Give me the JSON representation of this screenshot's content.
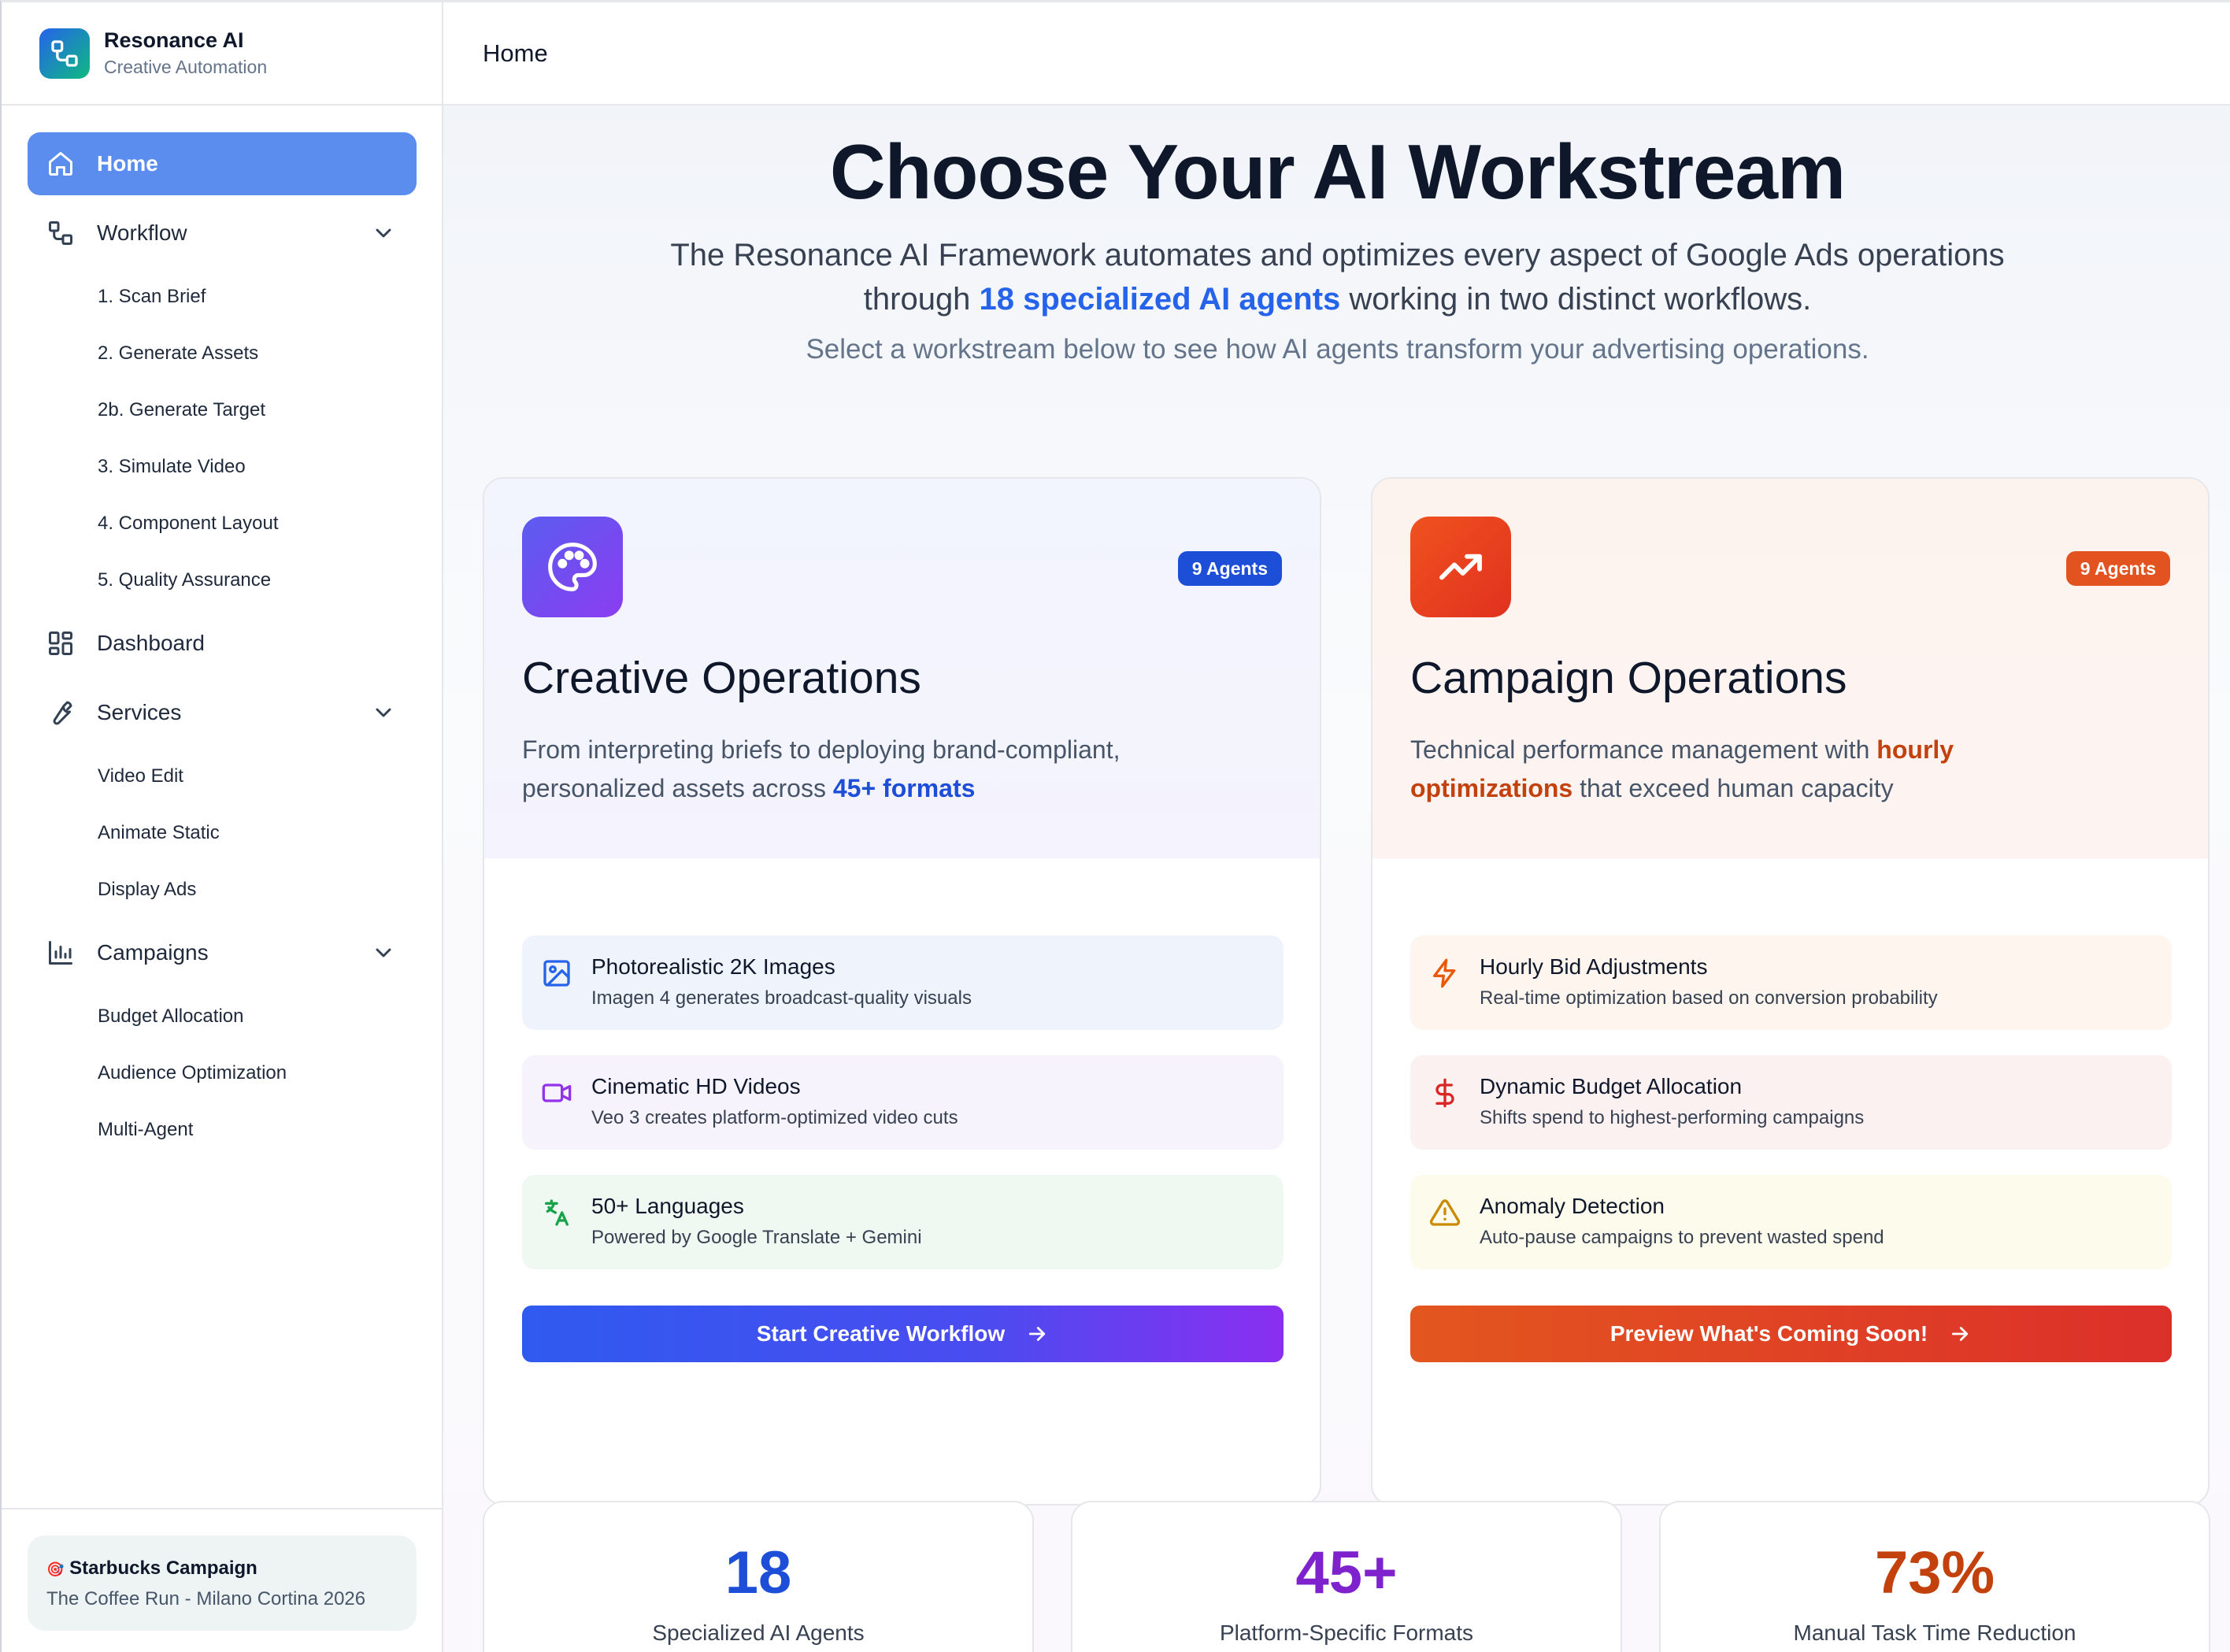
{
  "brand": {
    "name": "Resonance AI",
    "subtitle": "Creative Automation"
  },
  "sidebar": {
    "home": "Home",
    "workflow": {
      "label": "Workflow",
      "items": [
        "1. Scan Brief",
        "2. Generate Assets",
        "2b. Generate Target",
        "3. Simulate Video",
        "4. Component Layout",
        "5. Quality Assurance"
      ]
    },
    "dashboard": "Dashboard",
    "services": {
      "label": "Services",
      "items": [
        "Video Edit",
        "Animate Static",
        "Display Ads"
      ]
    },
    "campaigns": {
      "label": "Campaigns",
      "items": [
        "Budget Allocation",
        "Audience Optimization",
        "Multi-Agent"
      ]
    },
    "campaign_card": {
      "emoji": "🎯",
      "title": "Starbucks Campaign",
      "subtitle": "The Coffee Run - Milano Cortina 2026"
    }
  },
  "header": {
    "title": "Home"
  },
  "hero": {
    "title": "Choose Your AI Workstream",
    "line1": "The Resonance AI Framework automates and optimizes every aspect of Google Ads operations",
    "line2_pre": "through ",
    "line2_highlight": "18 specialized AI agents",
    "line2_post": " working in two distinct workflows.",
    "subtitle": "Select a workstream below to see how AI agents transform your advertising operations."
  },
  "creative": {
    "badge": "9 Agents",
    "title": "Creative Operations",
    "desc_pre": "From interpreting briefs to deploying brand-compliant, personalized assets across ",
    "desc_highlight": "45+ formats",
    "features": [
      {
        "icon": "image-icon",
        "title": "Photorealistic 2K Images",
        "sub": "Imagen 4 generates broadcast-quality visuals",
        "bg": "#eff4fc",
        "color": "#2563eb"
      },
      {
        "icon": "video-icon",
        "title": "Cinematic HD Videos",
        "sub": "Veo 3 creates platform-optimized video cuts",
        "bg": "#f6f3fc",
        "color": "#9333ea"
      },
      {
        "icon": "translate-icon",
        "title": "50+ Languages",
        "sub": "Powered by Google Translate + Gemini",
        "bg": "#eff9f1",
        "color": "#16a34a"
      }
    ],
    "cta": "Start Creative Workflow"
  },
  "campaign": {
    "badge": "9 Agents",
    "title": "Campaign Operations",
    "desc_pre": "Technical performance management with ",
    "desc_highlight": "hourly optimizations",
    "desc_post": " that exceed human capacity",
    "features": [
      {
        "icon": "lightning-icon",
        "title": "Hourly Bid Adjustments",
        "sub": "Real-time optimization based on conversion probability",
        "bg": "#fdf5ee",
        "color": "#ea580c"
      },
      {
        "icon": "dollar-icon",
        "title": "Dynamic Budget Allocation",
        "sub": "Shifts spend to highest-performing campaigns",
        "bg": "#fcf1f1",
        "color": "#dc2626"
      },
      {
        "icon": "warning-icon",
        "title": "Anomaly Detection",
        "sub": "Auto-pause campaigns to prevent wasted spend",
        "bg": "#fdfbeb",
        "color": "#ca8a04"
      }
    ],
    "cta": "Preview What's Coming Soon!"
  },
  "stats": [
    {
      "value": "18",
      "label": "Specialized AI Agents",
      "color": "#1d4ed8"
    },
    {
      "value": "45+",
      "label": "Platform-Specific Formats",
      "color": "#7e22ce"
    },
    {
      "value": "73%",
      "label": "Manual Task Time Reduction",
      "color": "#c2410c"
    }
  ]
}
